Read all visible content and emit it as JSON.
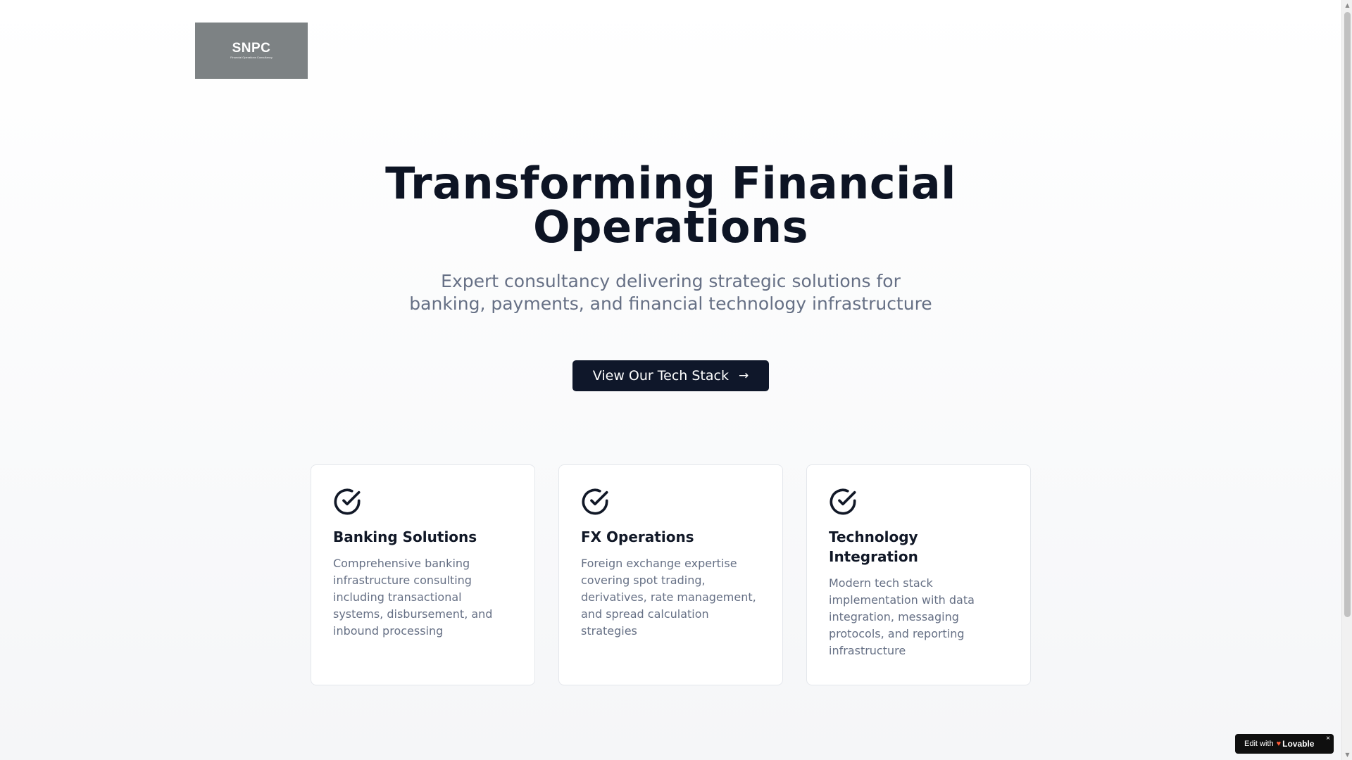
{
  "logo": {
    "name": "SNPC",
    "tagline": "Financial Operations Consultancy"
  },
  "hero": {
    "title": "Transforming Financial Operations",
    "subtitle": "Expert consultancy delivering strategic solutions for banking, payments, and financial technology infrastructure",
    "cta_label": "View Our Tech Stack",
    "cta_icon": "arrow-right-icon"
  },
  "cards": [
    {
      "icon": "check-circle-icon",
      "title": "Banking Solutions",
      "description": "Comprehensive banking infrastructure consulting including transactional systems, disbursement, and inbound processing"
    },
    {
      "icon": "check-circle-icon",
      "title": "FX Operations",
      "description": "Foreign exchange expertise covering spot trading, derivatives, rate management, and spread calculation strategies"
    },
    {
      "icon": "check-circle-icon",
      "title": "Technology Integration",
      "description": "Modern tech stack implementation with data integration, messaging protocols, and reporting infrastructure"
    }
  ],
  "badge": {
    "prefix": "Edit with",
    "brand": "Lovable",
    "close": "×"
  },
  "colors": {
    "primary": "#0f172a",
    "text_muted": "#667085",
    "logo_bg": "#7d8284",
    "badge_heart": "#ff5a36"
  }
}
